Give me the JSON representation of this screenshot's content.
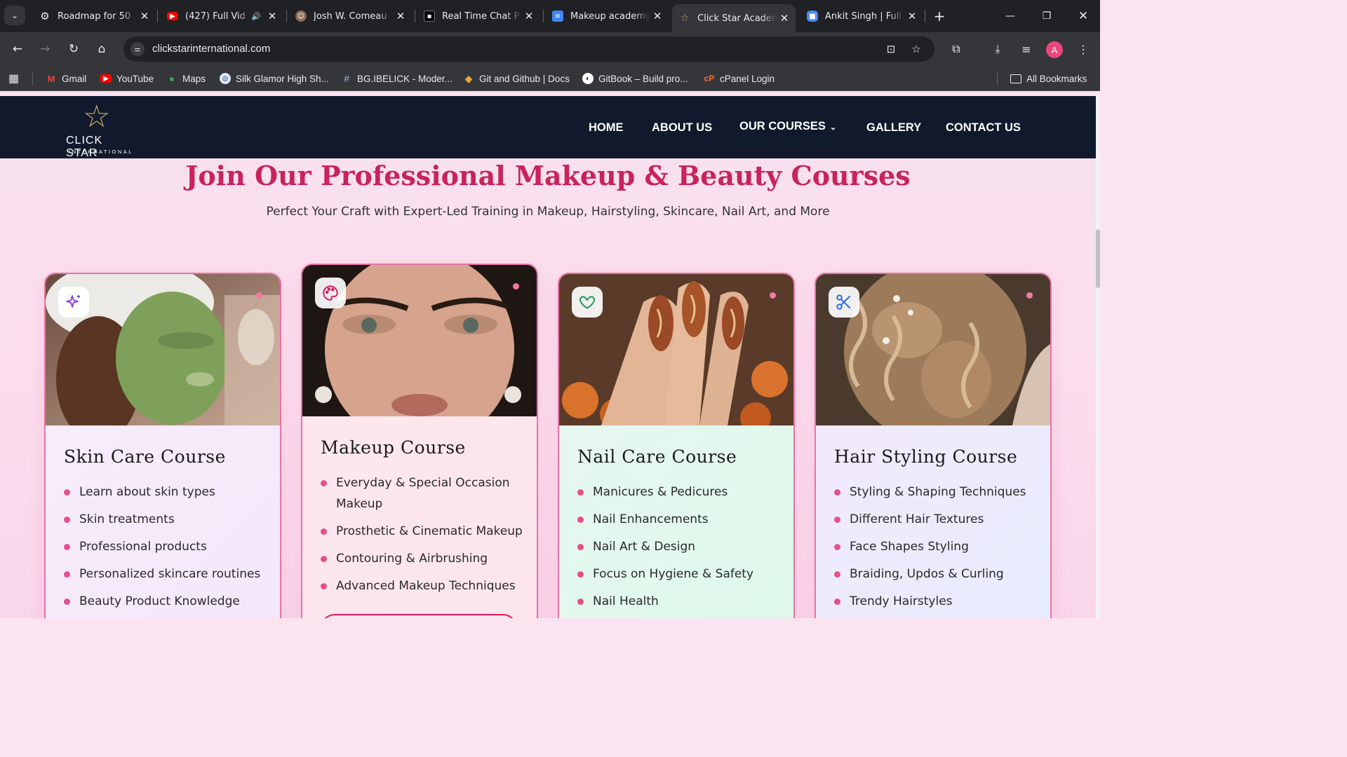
{
  "browser": {
    "tabs": [
      {
        "title": "Roadmap for 50 ",
        "icon": "openai-icon"
      },
      {
        "title": "(427) Full Vid",
        "icon": "youtube-icon",
        "audio": "🔊"
      },
      {
        "title": "Josh W. Comeau",
        "icon": "avatar-icon"
      },
      {
        "title": "Real Time Chat P",
        "icon": "chat-icon"
      },
      {
        "title": "Makeup academy",
        "icon": "forms-icon"
      },
      {
        "title": "Click Star Acaden",
        "icon": "star-icon",
        "active": true
      },
      {
        "title": "Ankit Singh | Full",
        "icon": "portfolio-icon"
      }
    ],
    "url": "clickstarinternational.com",
    "profile_initial": "A",
    "bookmarks": [
      {
        "label": "Gmail",
        "icon": "gmail-icon"
      },
      {
        "label": "YouTube",
        "icon": "youtube-icon"
      },
      {
        "label": "Maps",
        "icon": "maps-icon"
      },
      {
        "label": "Silk Glamor High Sh...",
        "icon": "globe-icon"
      },
      {
        "label": "BG.IBELICK - Moder...",
        "icon": "hash-icon"
      },
      {
        "label": "Git and Github | Docs",
        "icon": "git-icon"
      },
      {
        "label": "GitBook – Build pro...",
        "icon": "gitbook-icon"
      },
      {
        "label": "cPanel Login",
        "icon": "cpanel-icon"
      }
    ],
    "all_bookmarks": "All Bookmarks"
  },
  "site": {
    "logo": {
      "name": "CLICK STAR",
      "sub": "INTERNATIONAL"
    },
    "nav": {
      "home": "HOME",
      "about": "ABOUT US",
      "courses": "OUR COURSES",
      "gallery": "GALLERY",
      "contact": "CONTACT US"
    },
    "section": {
      "title": "Join Our Professional Makeup & Beauty Courses",
      "subtitle": "Perfect Your Craft with Expert-Led Training in Makeup, Hairstyling, Skincare, Nail Art, and More"
    },
    "courses": [
      {
        "title": "Skin Care Course",
        "icon": "sparkles-icon",
        "items": [
          "Learn about skin types",
          "Skin treatments",
          "Professional products",
          "Personalized skincare routines",
          "Beauty Product Knowledge"
        ]
      },
      {
        "title": "Makeup Course",
        "icon": "palette-icon",
        "items": [
          "Everyday & Special Occasion Makeup",
          "Prosthetic & Cinematic Makeup",
          "Contouring & Airbrushing",
          "Advanced Makeup Techniques"
        ]
      },
      {
        "title": "Nail Care Course",
        "icon": "heart-icon",
        "items": [
          "Manicures & Pedicures",
          "Nail Enhancements",
          "Nail Art & Design",
          "Focus on Hygiene & Safety",
          "Nail Health"
        ]
      },
      {
        "title": "Hair Styling Course",
        "icon": "scissors-icon",
        "items": [
          "Styling & Shaping Techniques",
          "Different Hair Textures",
          "Face Shapes Styling",
          "Braiding, Updos & Curling",
          "Trendy Hairstyles"
        ]
      }
    ]
  },
  "colors": {
    "header_bg": "#111a2c",
    "accent": "#c8235b",
    "bullet": "#e64f88",
    "card_border": "#e873a8"
  }
}
